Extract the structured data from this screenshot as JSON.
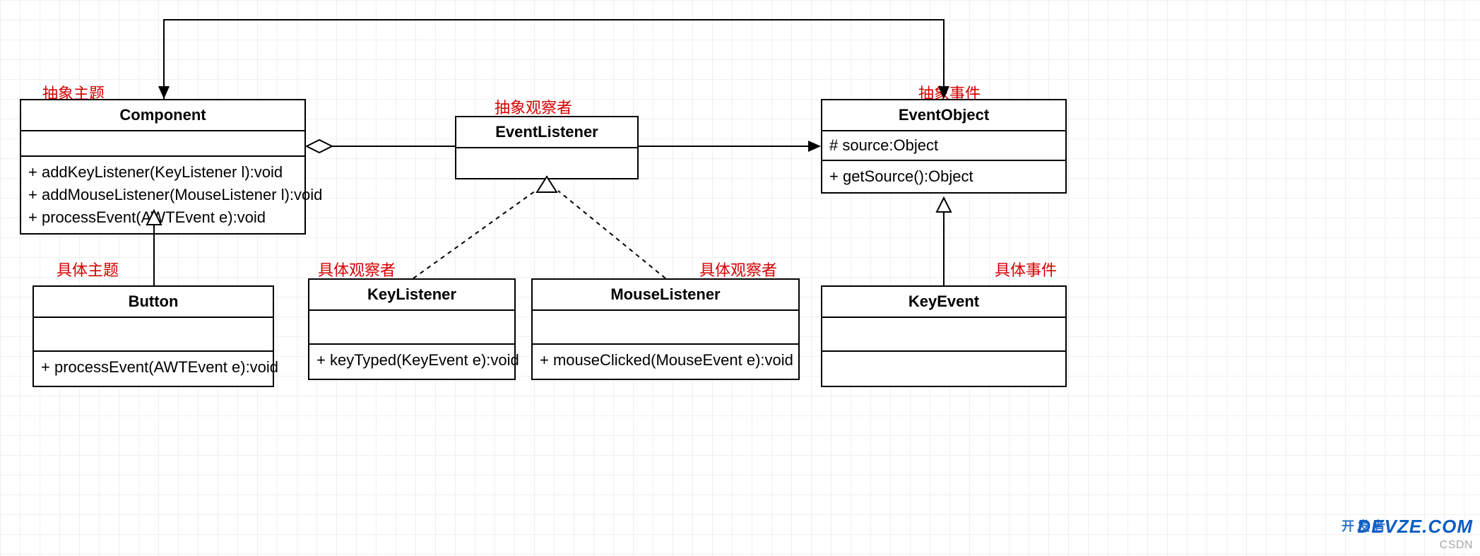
{
  "diagram_type": "UML class diagram — Observer pattern in AWT events",
  "labels": {
    "abstract_subject": "抽象主题",
    "concrete_subject": "具体主题",
    "abstract_observer": "抽象观察者",
    "concrete_observer_key": "具体观察者",
    "concrete_observer_mouse": "具体观察者",
    "abstract_event": "抽象事件",
    "concrete_event": "具体事件"
  },
  "classes": {
    "component": {
      "name": "Component",
      "ops": [
        "+ addKeyListener(KeyListener l):void",
        "+ addMouseListener(MouseListener l):void",
        "+ processEvent(AWTEvent e):void"
      ]
    },
    "button": {
      "name": "Button",
      "ops": [
        "+ processEvent(AWTEvent e):void"
      ]
    },
    "eventlistener": {
      "name": "EventListener"
    },
    "keylistener": {
      "name": "KeyListener",
      "ops": [
        "+ keyTyped(KeyEvent e):void"
      ]
    },
    "mouselistener": {
      "name": "MouseListener",
      "ops": [
        "+ mouseClicked(MouseEvent e):void"
      ]
    },
    "eventobject": {
      "name": "EventObject",
      "attrs": [
        "# source:Object"
      ],
      "ops": [
        "+ getSource():Object"
      ]
    },
    "keyevent": {
      "name": "KeyEvent"
    }
  },
  "relationships": [
    {
      "from": "Button",
      "to": "Component",
      "type": "generalization"
    },
    {
      "from": "KeyListener",
      "to": "EventListener",
      "type": "realization"
    },
    {
      "from": "MouseListener",
      "to": "EventListener",
      "type": "realization"
    },
    {
      "from": "KeyEvent",
      "to": "EventObject",
      "type": "generalization"
    },
    {
      "from": "EventListener",
      "to": "Component",
      "type": "aggregation"
    },
    {
      "from": "EventListener",
      "to": "EventObject",
      "type": "association_directed"
    },
    {
      "from": "Component",
      "to": "EventObject",
      "type": "association_directed"
    }
  ],
  "watermarks": {
    "csdn": "CSDN",
    "devze_cn": "开发者",
    "devze": "DEVZE.COM"
  }
}
